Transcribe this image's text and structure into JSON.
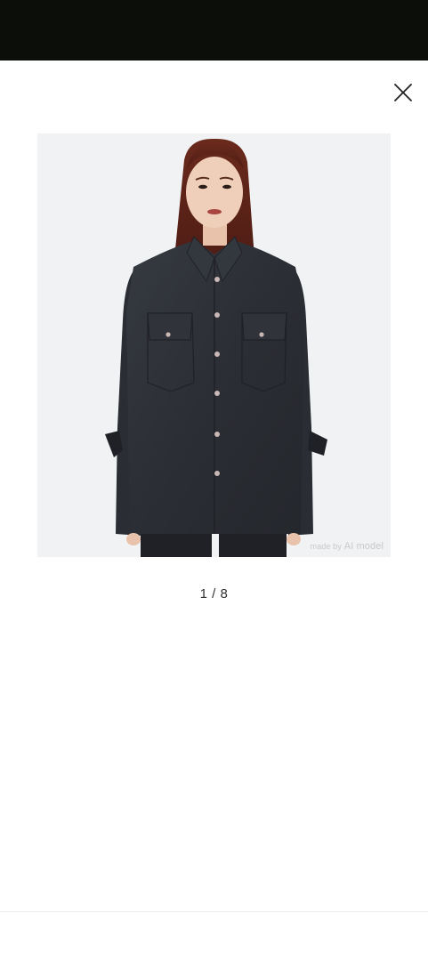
{
  "viewer": {
    "close_icon": "close-icon",
    "product_image": {
      "subject": "model-wearing-denim-shirt",
      "watermark_prefix": "made by",
      "watermark_suffix": "AI model"
    },
    "pagination": {
      "current": 1,
      "total": 8,
      "text": "1 / 8"
    }
  },
  "colors": {
    "status_bar": "#0c0e0a",
    "background": "#ffffff",
    "image_background": "#f1f2f4",
    "shirt": "#2c2f35",
    "pager_text": "#333333"
  }
}
